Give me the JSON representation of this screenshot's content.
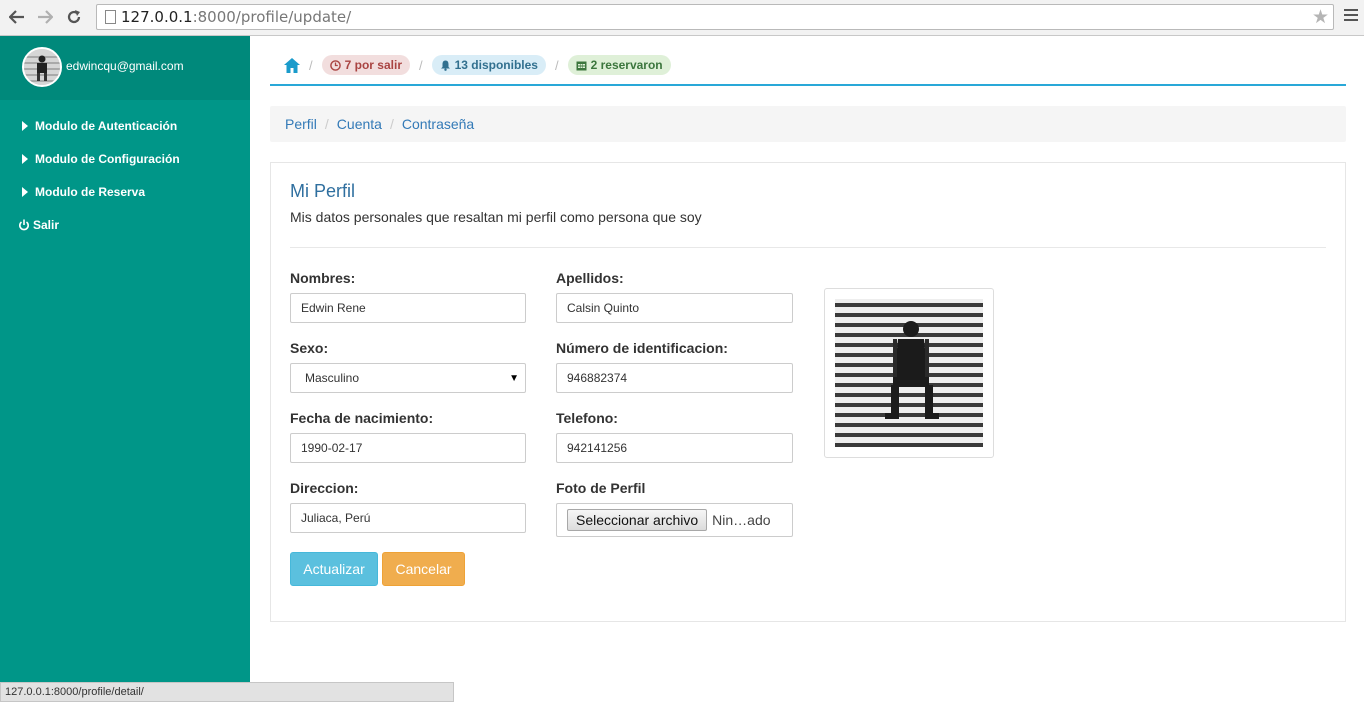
{
  "browser": {
    "url_host": "127.0.0.1",
    "url_rest": ":8000/profile/update/",
    "status_text": "127.0.0.1:8000/profile/detail/"
  },
  "sidebar": {
    "user_email": "edwincqu@gmail.com",
    "items": [
      {
        "label": "Modulo de Autenticación",
        "icon": "caret-right-icon"
      },
      {
        "label": "Modulo de Configuración",
        "icon": "caret-right-icon"
      },
      {
        "label": "Modulo de Reserva",
        "icon": "caret-right-icon"
      },
      {
        "label": "Salir",
        "icon": "power-icon"
      }
    ]
  },
  "topbar": {
    "pills": [
      {
        "label": "7 por salir",
        "icon": "clock-icon",
        "color": "#a94442"
      },
      {
        "label": "13 disponibles",
        "icon": "bell-icon",
        "color": "#31708f"
      },
      {
        "label": "2 reservaron",
        "icon": "calendar-icon",
        "color": "#3c763d"
      }
    ]
  },
  "breadcrumb": [
    "Perfil",
    "Cuenta",
    "Contraseña"
  ],
  "profile": {
    "title": "Mi Perfil",
    "subtitle": "Mis datos personales que resaltan mi perfil como persona que soy",
    "fields": {
      "nombres": {
        "label": "Nombres:",
        "value": "Edwin Rene"
      },
      "apellidos": {
        "label": "Apellidos:",
        "value": "Calsin Quinto"
      },
      "sexo": {
        "label": "Sexo:",
        "value": "Masculino"
      },
      "numero": {
        "label": "Número de identificacion:",
        "value": "946882374"
      },
      "fecha": {
        "label": "Fecha de nacimiento:",
        "value": "1990-02-17"
      },
      "telefono": {
        "label": "Telefono:",
        "value": "942141256"
      },
      "direccion": {
        "label": "Direccion:",
        "value": "Juliaca, Perú"
      },
      "foto": {
        "label": "Foto de Perfil",
        "button": "Seleccionar archivo",
        "filename": "Nin…ado"
      }
    },
    "buttons": {
      "update": "Actualizar",
      "cancel": "Cancelar"
    }
  },
  "colors": {
    "sidebar": "#009688",
    "accent": "#29a8d8",
    "primary": "#5bc0de",
    "warning": "#f0ad4e"
  }
}
